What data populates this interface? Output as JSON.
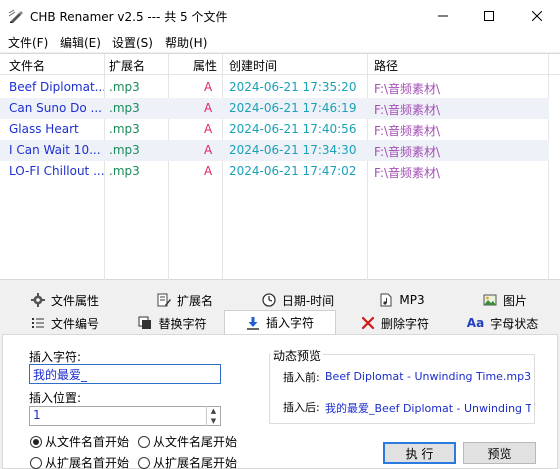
{
  "window": {
    "title": "CHB Renamer v2.5 --- 共 5 个文件",
    "minimize_glyph": "—",
    "maximize_glyph": "☐",
    "close_glyph": "✕"
  },
  "menu": {
    "items": [
      "文件(F)",
      "编辑(E)",
      "设置(S)",
      "帮助(H)"
    ]
  },
  "file_list": {
    "columns": [
      "文件名",
      "扩展名",
      "属性",
      "创建时间",
      "路径"
    ],
    "rows": [
      {
        "name": "Beef Diplomat...",
        "ext": ".mp3",
        "attr": "A",
        "created": "2024-06-21 17:35:20",
        "path": "F:\\音频素材\\"
      },
      {
        "name": "Can Suno Do ...",
        "ext": ".mp3",
        "attr": "A",
        "created": "2024-06-21 17:46:19",
        "path": "F:\\音频素材\\"
      },
      {
        "name": "Glass Heart",
        "ext": ".mp3",
        "attr": "A",
        "created": "2024-06-21 17:40:56",
        "path": "F:\\音频素材\\"
      },
      {
        "name": "I Can Wait 10...",
        "ext": ".mp3",
        "attr": "A",
        "created": "2024-06-21 17:34:30",
        "path": "F:\\音频素材\\"
      },
      {
        "name": "LO-FI Chillout ...",
        "ext": ".mp3",
        "attr": "A",
        "created": "2024-06-21 17:47:02",
        "path": "F:\\音频素材\\"
      }
    ]
  },
  "tabs": {
    "row1": [
      {
        "label": "文件属性",
        "icon": "gear-icon"
      },
      {
        "label": "扩展名",
        "icon": "document-edit-icon"
      },
      {
        "label": "日期-时间",
        "icon": "clock-icon"
      },
      {
        "label": "MP3",
        "icon": "music-file-icon"
      },
      {
        "label": "图片",
        "icon": "image-icon"
      }
    ],
    "row2": [
      {
        "label": "文件编号",
        "icon": "numbered-list-icon"
      },
      {
        "label": "替换字符",
        "icon": "replace-icon"
      },
      {
        "label": "插入字符",
        "icon": "insert-down-arrow-icon",
        "active": true
      },
      {
        "label": "删除字符",
        "icon": "delete-x-icon"
      },
      {
        "label": "字母状态",
        "icon": "letter-case-icon"
      }
    ]
  },
  "insert_panel": {
    "insert_chars_label": "插入字符:",
    "insert_chars_value": "我的最爱_",
    "insert_pos_label": "插入位置:",
    "insert_pos_value": "1",
    "preview_group_title": "动态预览",
    "before_label": "插入前:",
    "before_value": "Beef Diplomat - Unwinding Time.mp3",
    "after_label": "插入后:",
    "after_value": "我的最爱_Beef Diplomat - Unwinding Time",
    "radios": [
      {
        "label": "从文件名首开始",
        "checked": true
      },
      {
        "label": "从文件名尾开始",
        "checked": false
      },
      {
        "label": "从扩展名首开始",
        "checked": false
      },
      {
        "label": "从扩展名尾开始",
        "checked": false
      }
    ],
    "execute_label": "执 行",
    "preview_label": "预览"
  },
  "colors": {
    "filename": "#1c2fd1",
    "ext": "#1a8a5a",
    "attr": "#e0246b",
    "time": "#1aa0b8",
    "path": "#a44fb5",
    "accent": "#2a7ae0"
  }
}
